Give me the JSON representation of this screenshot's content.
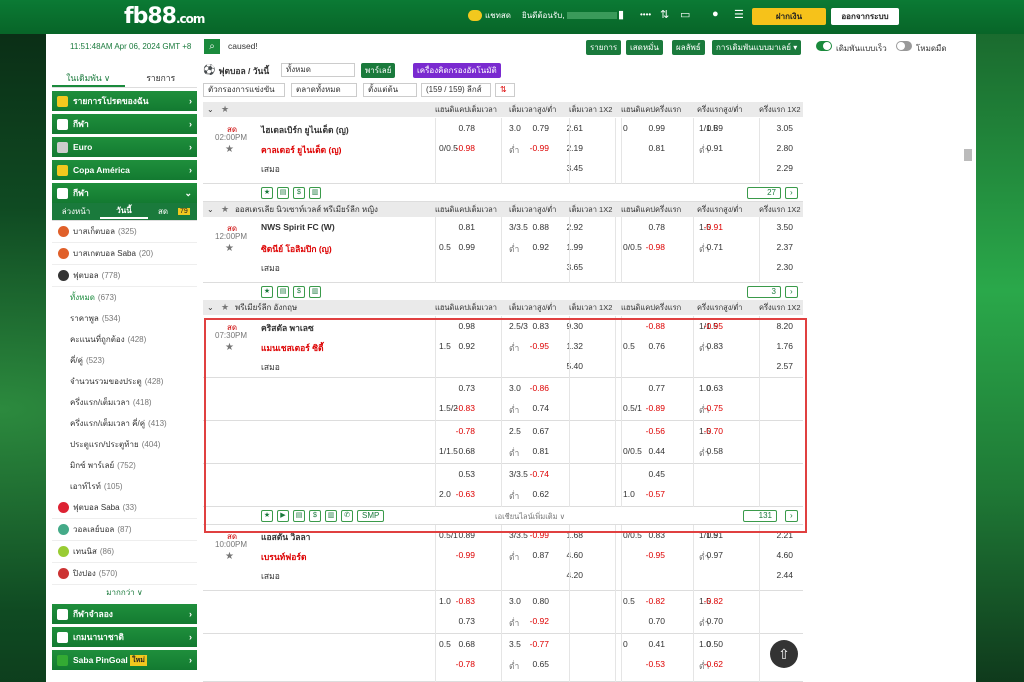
{
  "header": {
    "logo": "fb88",
    "logo_suffix": ".com",
    "chat": "แชทสด",
    "balance_label": "ยินดีต้อนรับ,",
    "deposit": "ฝากเงิน",
    "logout": "ออกจากระบบ"
  },
  "toolbar": {
    "datetime": "11:51:48AM Apr 06, 2024 GMT +8",
    "search_value": "caused!",
    "btn_list": "รายการ",
    "btn_result": "เสดหมั่น",
    "btn_stats": "ผลลัพธ์",
    "btn_settings": "การเดิมพันแบบมาเลย์ ▾",
    "toggle1": "เดิมพันแบบเร็ว",
    "toggle2": "โหมดมืด"
  },
  "sidebar": {
    "tab_bet": "ในเดิมพัน ∨",
    "tab_list": "รายการ",
    "heads": [
      "รายการโปรดของฉัน",
      "กีฬา",
      "Euro",
      "Copa América",
      "กีฬา"
    ],
    "subtabs": [
      "ล่วงหน้า",
      "วันนี้",
      "สด"
    ],
    "live_count": "79",
    "sports": [
      {
        "name": "บาสเก็ตบอล",
        "count": "(325)",
        "color": "#e0602a"
      },
      {
        "name": "บาสเกตบอล Saba",
        "count": "(20)",
        "color": "#e0602a"
      },
      {
        "name": "ฟุตบอล",
        "count": "(778)",
        "color": "#333"
      }
    ],
    "football_subs": [
      {
        "name": "ทั้งหมด",
        "count": "(673)"
      },
      {
        "name": "ราคาพูล",
        "count": "(534)"
      },
      {
        "name": "คะแนนที่ถูกต้อง",
        "count": "(428)"
      },
      {
        "name": "คี่/คู่",
        "count": "(523)"
      },
      {
        "name": "จำนวนรวมของประตู",
        "count": "(428)"
      },
      {
        "name": "ครึ่งแรก/เต็มเวลา",
        "count": "(418)"
      },
      {
        "name": "ครึ่งแรก/เต็มเวลา คี่/คู่",
        "count": "(413)"
      },
      {
        "name": "ประตูแรก/ประตูท้าย",
        "count": "(404)"
      },
      {
        "name": "มิกซ์ พาร์เลย์",
        "count": "(752)"
      },
      {
        "name": "เอาท์ไรท์",
        "count": "(105)"
      }
    ],
    "sports2": [
      {
        "name": "ฟุตบอล Saba",
        "count": "(33)",
        "color": "#d23"
      },
      {
        "name": "วอลเลย์บอล",
        "count": "(87)",
        "color": "#4a8"
      },
      {
        "name": "เทนนิส",
        "count": "(86)",
        "color": "#9c3"
      },
      {
        "name": "ปิงปอง",
        "count": "(570)",
        "color": "#c33"
      }
    ],
    "more": "มากกว่า ∨",
    "heads2": [
      "กีฬาจำลอง",
      "เกมนานาชาติ",
      "Saba PinGoal"
    ],
    "new_badge": "ใหม่"
  },
  "main": {
    "sport_title": "ฟุตบอล / วันนี้",
    "sport_dd": "ทั้งหมด",
    "parlay": "พาร์เลย์",
    "calc": "เครื่องคิดกรองอัตโนมัติ",
    "filter1": "ตัวกรองการแข่งขัน",
    "filter2": "ตลาดทั้งหมด",
    "filter3": "ตั้งแต่ต้น",
    "league_count": "(159 / 159) ลีกส์",
    "cols": [
      "แฮนดิแคปเต็มเวลา",
      "เต็มเวลาสูง/ต่ำ",
      "เต็มเวลา 1X2",
      "แฮนดิแคปครึ่งแรก",
      "ครึ่งแรกสูง/ต่ำ",
      "ครึ่งแรก 1X2"
    ],
    "leagues": [
      "ออสเตรเลีย นิวเซาท์เวลส์ พรีเมียร์ลีก หญิง",
      "พรีเมียร์ลีก อังกฤษ"
    ],
    "match0": {
      "status": "สด",
      "time": "02:00PM",
      "home": "ไฮเดลเบิร์ก ยูไนเต็ด (ญ)",
      "away": "คาลเดอร์ ยูไนเต็ด (ญ)",
      "draw": "เสมอ",
      "pg": "27"
    },
    "match1": {
      "status": "สด",
      "time": "12:00PM",
      "home": "NWS Spirit FC (W)",
      "away": "ซิดนีย์ โอลิมปิก (ญ)",
      "draw": "เสมอ",
      "pg": "3"
    },
    "match2": {
      "status": "สด",
      "time": "07:30PM",
      "home": "คริสตัล พาเลซ",
      "away": "แมนเชสเตอร์ ซิตี้",
      "draw": "เสมอ",
      "pg": "131",
      "more_lines": "เอเชียนไลน์เพิ่มเติม ∨",
      "smp": "SMP"
    },
    "match3": {
      "status": "สด",
      "time": "10:00PM",
      "home": "แอสตัน วิลลา",
      "away": "เบรนท์ฟอร์ด",
      "draw": "เสมอ"
    }
  }
}
